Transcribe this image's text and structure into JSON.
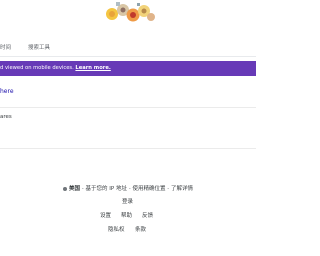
{
  "tabs": {
    "time": "时间",
    "tools": "搜索工具"
  },
  "banner": {
    "text": "d viewed on mobile devices.",
    "link": "Learn more."
  },
  "results": {
    "here_link": "here",
    "ares_text": "ares"
  },
  "footer": {
    "location_country": "美国",
    "location_sep1": " - ",
    "location_ip": "基于您的 IP 地址",
    "location_sep2": " - ",
    "location_precise": "使用精确位置",
    "location_sep3": " - ",
    "location_learn": "了解详情",
    "login": "登录",
    "settings": "设置",
    "help": "帮助",
    "feedback": "反馈",
    "privacy": "隐私权",
    "terms": "条款"
  },
  "colors": {
    "banner_bg": "#673ab7",
    "link_blue": "#1a0dab"
  }
}
